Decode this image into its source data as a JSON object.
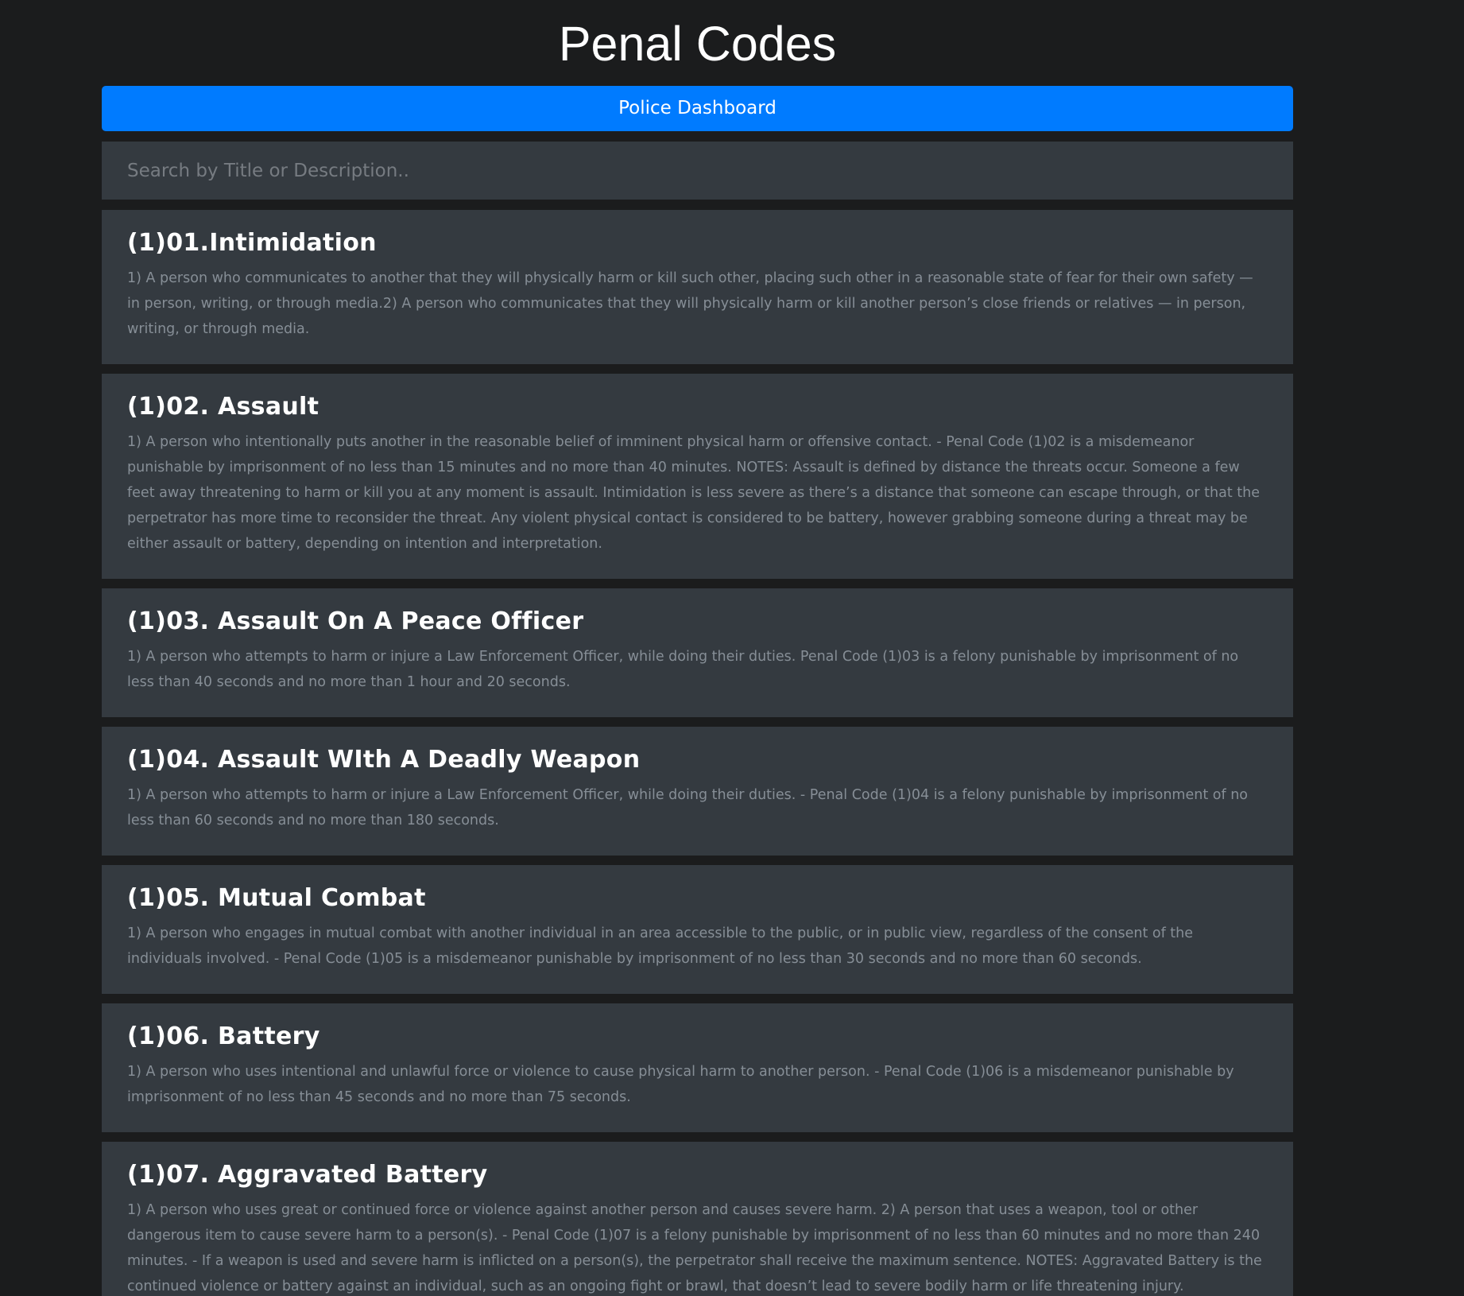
{
  "header": {
    "title": "Penal Codes"
  },
  "nav": {
    "dashboard_label": "Police Dashboard"
  },
  "search": {
    "placeholder": "Search by Title or Description..",
    "value": ""
  },
  "codes": [
    {
      "title": "(1)01.Intimidation",
      "description": "1) A person who communicates to another that they will physically harm or kill such other, placing such other in a reasonable state of fear for their own safety — in person, writing, or through media.2) A person who communicates that they will physically harm or kill another person’s close friends or relatives — in person, writing, or through media."
    },
    {
      "title": "(1)02. Assault",
      "description": "1) A person who intentionally puts another in the reasonable belief of imminent physical harm or offensive contact. - Penal Code (1)02 is a misdemeanor punishable by imprisonment of no less than 15 minutes and no more than 40 minutes. NOTES: Assault is defined by distance the threats occur. Someone a few feet away threatening to harm or kill you at any moment is assault. Intimidation is less severe as there’s a distance that someone can escape through, or that the perpetrator has more time to reconsider the threat. Any violent physical contact is considered to be battery, however grabbing someone during a threat may be either assault or battery, depending on intention and interpretation."
    },
    {
      "title": "(1)03. Assault On A Peace Officer",
      "description": "1) A person who attempts to harm or injure a Law Enforcement Officer, while doing their duties. Penal Code (1)03 is a felony punishable by imprisonment of no less than 40 seconds and no more than 1 hour and 20 seconds."
    },
    {
      "title": "(1)04. Assault WIth A Deadly Weapon",
      "description": "1) A person who attempts to harm or injure a Law Enforcement Officer, while doing their duties. - Penal Code (1)04 is a felony punishable by imprisonment of no less than 60 seconds and no more than 180 seconds."
    },
    {
      "title": "(1)05. Mutual Combat",
      "description": "1) A person who engages in mutual combat with another individual in an area accessible to the public, or in public view, regardless of the consent of the individuals involved. - Penal Code (1)05 is a misdemeanor punishable by imprisonment of no less than 30 seconds and no more than 60 seconds."
    },
    {
      "title": "(1)06. Battery",
      "description": "1) A person who uses intentional and unlawful force or violence to cause physical harm to another person. - Penal Code (1)06 is a misdemeanor punishable by imprisonment of no less than 45 seconds and no more than 75 seconds."
    },
    {
      "title": "(1)07. Aggravated Battery",
      "description": "1) A person who uses great or continued force or violence against another person and causes severe harm. 2) A person that uses a weapon, tool or other dangerous item to cause severe harm to a person(s). - Penal Code (1)07 is a felony punishable by imprisonment of no less than 60 minutes and no more than 240 minutes. - If a weapon is used and severe harm is inflicted on a person(s), the perpetrator shall receive the maximum sentence. NOTES: Aggravated Battery is the continued violence or battery against an individual, such as an ongoing fight or brawl, that doesn’t lead to severe bodily harm or life threatening injury."
    }
  ]
}
